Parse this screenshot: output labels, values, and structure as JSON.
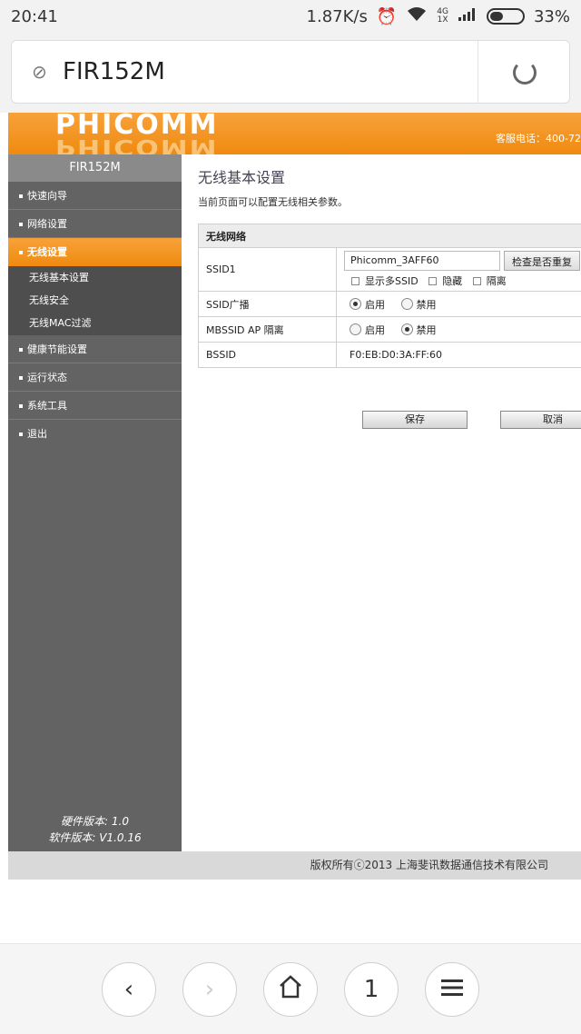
{
  "statusbar": {
    "time": "20:41",
    "speed": "1.87K/s",
    "network_type": "4G",
    "network_type_2": "1X",
    "battery": "33%",
    "icons": [
      "alarm-icon",
      "wifi-icon",
      "signal-icon",
      "battery-icon"
    ]
  },
  "browser": {
    "url": "FIR152M"
  },
  "router": {
    "logo": "PHICOMM",
    "hotline": "客服电话：400-72",
    "sidebar": {
      "title": "FIR152M",
      "items": [
        {
          "label": "快速向导"
        },
        {
          "label": "网络设置"
        },
        {
          "label": "无线设置"
        },
        {
          "label": "健康节能设置"
        },
        {
          "label": "运行状态"
        },
        {
          "label": "系统工具"
        },
        {
          "label": "退出"
        }
      ],
      "subitems": [
        {
          "label": "无线基本设置"
        },
        {
          "label": "无线安全"
        },
        {
          "label": "无线MAC过滤"
        }
      ],
      "hw_version": "硬件版本: 1.0",
      "sw_version": "软件版本: V1.0.16"
    },
    "content": {
      "title": "无线基本设置",
      "description": "当前页面可以配置无线相关参数。",
      "section_header": "无线网络",
      "ssid1_label": "SSID1",
      "ssid1_value": "Phicomm_3AFF60",
      "check_button": "检查是否重复",
      "show_multi_ssid": "显示多SSID",
      "hide": "隐藏",
      "isolate": "隔离",
      "broadcast_label": "SSID广播",
      "enable": "启用",
      "disable": "禁用",
      "mbssid_label": "MBSSID AP 隔离",
      "bssid_label": "BSSID",
      "bssid_value": "F0:EB:D0:3A:FF:60",
      "save": "保存",
      "cancel": "取消"
    },
    "footer": "版权所有ⓒ2013 上海斐讯数据通信技术有限公司"
  },
  "bottomnav": {
    "tabs_count": "1"
  }
}
